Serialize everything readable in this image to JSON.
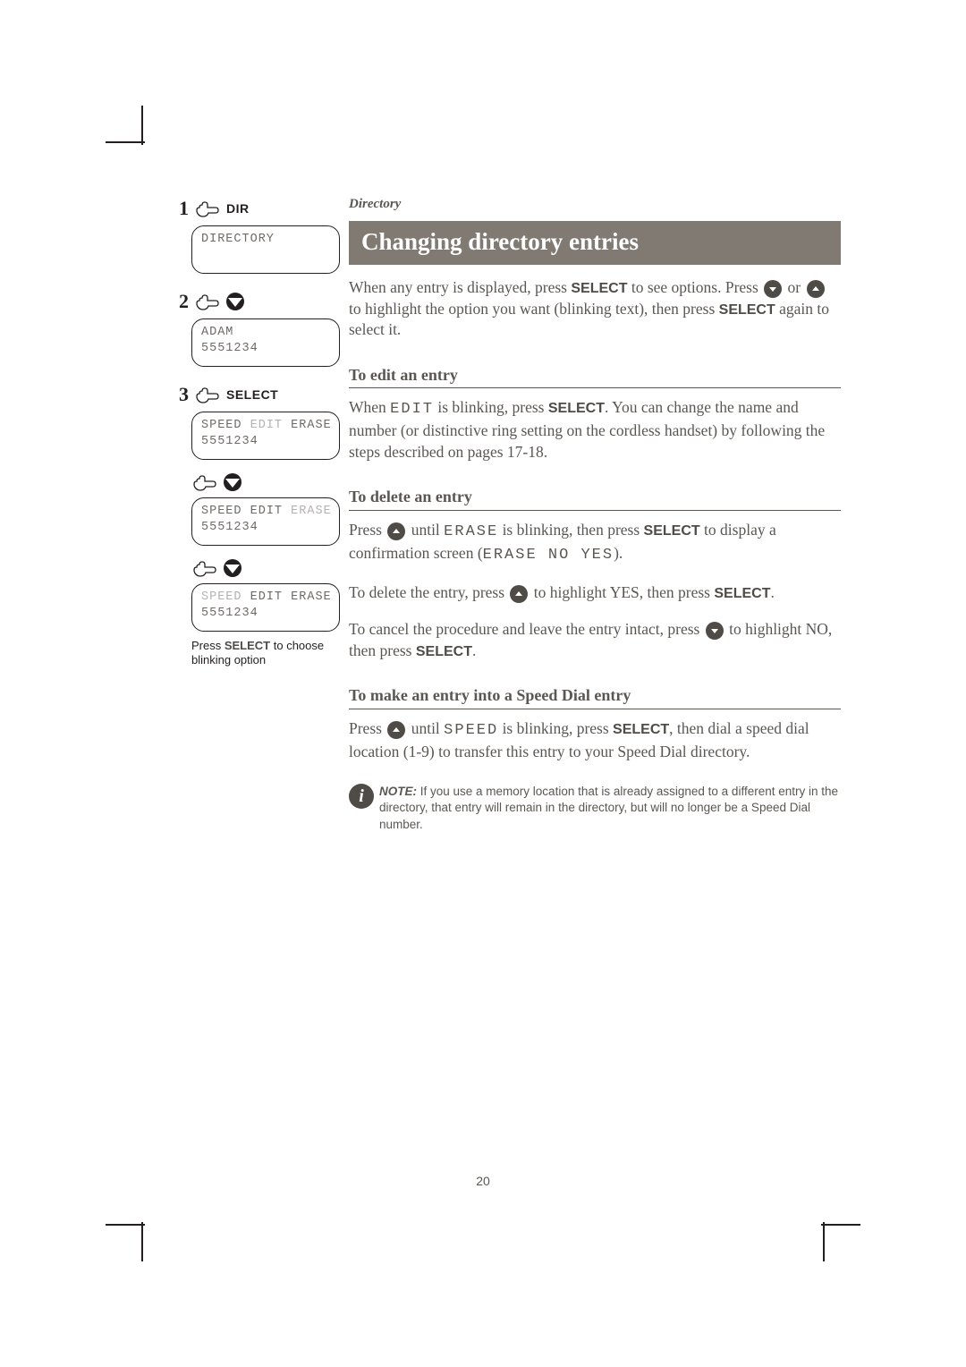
{
  "breadcrumb": "Directory",
  "title": "Changing directory entries",
  "page_number": "20",
  "intro": {
    "line1a": "When any entry is displayed, press ",
    "select1": "SELECT",
    "line1b": " to see options. Press ",
    "or": " or ",
    "line1c": " to highlight the option you want (blinking text), then press ",
    "select2": "SELECT",
    "line1d": " again to select it."
  },
  "sections": {
    "edit": {
      "heading": "To edit an entry",
      "a": "When ",
      "edit_word": "EDIT",
      "b": " is blinking, press ",
      "select": "SELECT",
      "c": ". You can change the name and number (or distinctive ring setting on the cordless handset) by following the steps described on pages 17-18."
    },
    "delete": {
      "heading": "To delete an entry",
      "p1a": "Press ",
      "p1b": " until ",
      "erase_word": "ERASE",
      "p1c": " is blinking, then press ",
      "select1": "SELECT",
      "p1d": " to display a confirmation screen (",
      "confirm": "ERASE NO YES",
      "p1e": ").",
      "p2a": "To delete the entry, press ",
      "p2b": " to highlight YES, then press ",
      "select2": "SELECT",
      "p2c": ".",
      "p3a": "To cancel the procedure and leave the entry intact, press ",
      "p3b": " to highlight NO, then press ",
      "select3": "SELECT",
      "p3c": "."
    },
    "speed": {
      "heading": "To make an entry into a Speed Dial entry",
      "a": "Press ",
      "b": " until ",
      "speed_word": "SPEED",
      "c": " is blinking, press ",
      "select": "SELECT",
      "d": ", then dial a speed dial location (1-9) to transfer this entry to your Speed Dial directory."
    }
  },
  "note": {
    "label": "NOTE:",
    "text": " If you use a memory location that is already assigned to a different entry in the directory, that entry will remain in the directory, but will no longer be a Speed Dial number."
  },
  "left": {
    "step1": {
      "num": "1",
      "label": "DIR",
      "lcd": {
        "l1": "DIRECTORY"
      }
    },
    "step2": {
      "num": "2",
      "lcd": {
        "l1": "ADAM",
        "l2": "5551234"
      }
    },
    "step3": {
      "num": "3",
      "label": "SELECT",
      "lcdA": {
        "speed": "SPEED",
        "edit": "EDIT",
        "erase": "ERASE",
        "l2": "5551234"
      },
      "lcdB": {
        "speed": "SPEED",
        "edit": "EDIT",
        "erase": "ERASE",
        "l2": "5551234"
      },
      "lcdC": {
        "speed": "SPEED",
        "edit": "EDIT",
        "erase": "ERASE",
        "l2": "5551234"
      }
    },
    "caption_a": "Press ",
    "caption_sel": "SELECT",
    "caption_b": " to choose blinking option"
  }
}
